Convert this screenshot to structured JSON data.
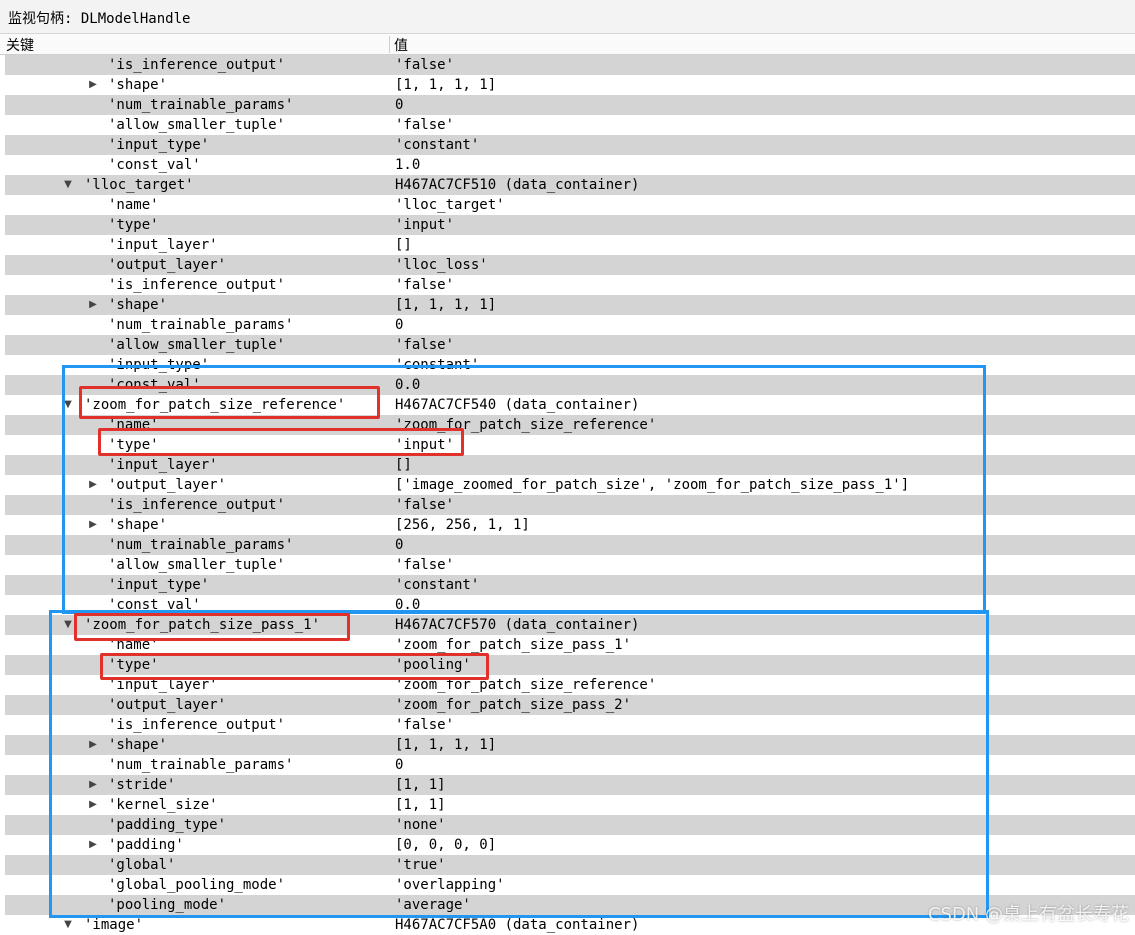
{
  "window": {
    "title": "监视句柄: DLModelHandle"
  },
  "columns": {
    "key": "关键",
    "value": "值"
  },
  "rows": [
    {
      "level": 2,
      "expandable": false,
      "key": "'is_inference_output'",
      "value": "'false'"
    },
    {
      "level": 2,
      "expandable": true,
      "key": "'shape'",
      "value": "[1, 1, 1, 1]"
    },
    {
      "level": 2,
      "expandable": false,
      "key": "'num_trainable_params'",
      "value": "0"
    },
    {
      "level": 2,
      "expandable": false,
      "key": "'allow_smaller_tuple'",
      "value": "'false'"
    },
    {
      "level": 2,
      "expandable": false,
      "key": "'input_type'",
      "value": "'constant'"
    },
    {
      "level": 2,
      "expandable": false,
      "key": "'const_val'",
      "value": "1.0"
    },
    {
      "level": 1,
      "expandable": true,
      "expanded": true,
      "key": "'lloc_target'",
      "value": "H467AC7CF510 (data_container)"
    },
    {
      "level": 2,
      "expandable": false,
      "key": "'name'",
      "value": "'lloc_target'"
    },
    {
      "level": 2,
      "expandable": false,
      "key": "'type'",
      "value": "'input'"
    },
    {
      "level": 2,
      "expandable": false,
      "key": "'input_layer'",
      "value": "[]"
    },
    {
      "level": 2,
      "expandable": false,
      "key": "'output_layer'",
      "value": "'lloc_loss'"
    },
    {
      "level": 2,
      "expandable": false,
      "key": "'is_inference_output'",
      "value": "'false'"
    },
    {
      "level": 2,
      "expandable": true,
      "key": "'shape'",
      "value": "[1, 1, 1, 1]"
    },
    {
      "level": 2,
      "expandable": false,
      "key": "'num_trainable_params'",
      "value": "0"
    },
    {
      "level": 2,
      "expandable": false,
      "key": "'allow_smaller_tuple'",
      "value": "'false'"
    },
    {
      "level": 2,
      "expandable": false,
      "key": "'input_type'",
      "value": "'constant'"
    },
    {
      "level": 2,
      "expandable": false,
      "key": "'const_val'",
      "value": "0.0"
    },
    {
      "level": 1,
      "expandable": true,
      "expanded": true,
      "key": "'zoom_for_patch_size_reference'",
      "value": "H467AC7CF540 (data_container)"
    },
    {
      "level": 2,
      "expandable": false,
      "key": "'name'",
      "value": "'zoom_for_patch_size_reference'"
    },
    {
      "level": 2,
      "expandable": false,
      "key": "'type'",
      "value": "'input'"
    },
    {
      "level": 2,
      "expandable": false,
      "key": "'input_layer'",
      "value": "[]"
    },
    {
      "level": 2,
      "expandable": true,
      "key": "'output_layer'",
      "value": "['image_zoomed_for_patch_size', 'zoom_for_patch_size_pass_1']"
    },
    {
      "level": 2,
      "expandable": false,
      "key": "'is_inference_output'",
      "value": "'false'"
    },
    {
      "level": 2,
      "expandable": true,
      "key": "'shape'",
      "value": "[256, 256, 1, 1]"
    },
    {
      "level": 2,
      "expandable": false,
      "key": "'num_trainable_params'",
      "value": "0"
    },
    {
      "level": 2,
      "expandable": false,
      "key": "'allow_smaller_tuple'",
      "value": "'false'"
    },
    {
      "level": 2,
      "expandable": false,
      "key": "'input_type'",
      "value": "'constant'"
    },
    {
      "level": 2,
      "expandable": false,
      "key": "'const_val'",
      "value": "0.0"
    },
    {
      "level": 1,
      "expandable": true,
      "expanded": true,
      "key": "'zoom_for_patch_size_pass_1'",
      "value": "H467AC7CF570 (data_container)"
    },
    {
      "level": 2,
      "expandable": false,
      "key": "'name'",
      "value": "'zoom_for_patch_size_pass_1'"
    },
    {
      "level": 2,
      "expandable": false,
      "key": "'type'",
      "value": "'pooling'"
    },
    {
      "level": 2,
      "expandable": false,
      "key": "'input_layer'",
      "value": "'zoom_for_patch_size_reference'"
    },
    {
      "level": 2,
      "expandable": false,
      "key": "'output_layer'",
      "value": "'zoom_for_patch_size_pass_2'"
    },
    {
      "level": 2,
      "expandable": false,
      "key": "'is_inference_output'",
      "value": "'false'"
    },
    {
      "level": 2,
      "expandable": true,
      "key": "'shape'",
      "value": "[1, 1, 1, 1]"
    },
    {
      "level": 2,
      "expandable": false,
      "key": "'num_trainable_params'",
      "value": "0"
    },
    {
      "level": 2,
      "expandable": true,
      "key": "'stride'",
      "value": "[1, 1]"
    },
    {
      "level": 2,
      "expandable": true,
      "key": "'kernel_size'",
      "value": "[1, 1]"
    },
    {
      "level": 2,
      "expandable": false,
      "key": "'padding_type'",
      "value": "'none'"
    },
    {
      "level": 2,
      "expandable": true,
      "key": "'padding'",
      "value": "[0, 0, 0, 0]"
    },
    {
      "level": 2,
      "expandable": false,
      "key": "'global'",
      "value": "'true'"
    },
    {
      "level": 2,
      "expandable": false,
      "key": "'global_pooling_mode'",
      "value": "'overlapping'"
    },
    {
      "level": 2,
      "expandable": false,
      "key": "'pooling_mode'",
      "value": "'average'"
    },
    {
      "level": 1,
      "expandable": true,
      "expanded": true,
      "key": "'image'",
      "value": "H467AC7CF5A0 (data_container)"
    }
  ],
  "icons": {
    "collapsed": "triangle-right-icon",
    "expanded": "triangle-down-icon"
  },
  "highlight_colors": {
    "blue": "#2196f3",
    "red": "#e0312a"
  },
  "watermark": "CSDN @桌上有盆长寿花"
}
